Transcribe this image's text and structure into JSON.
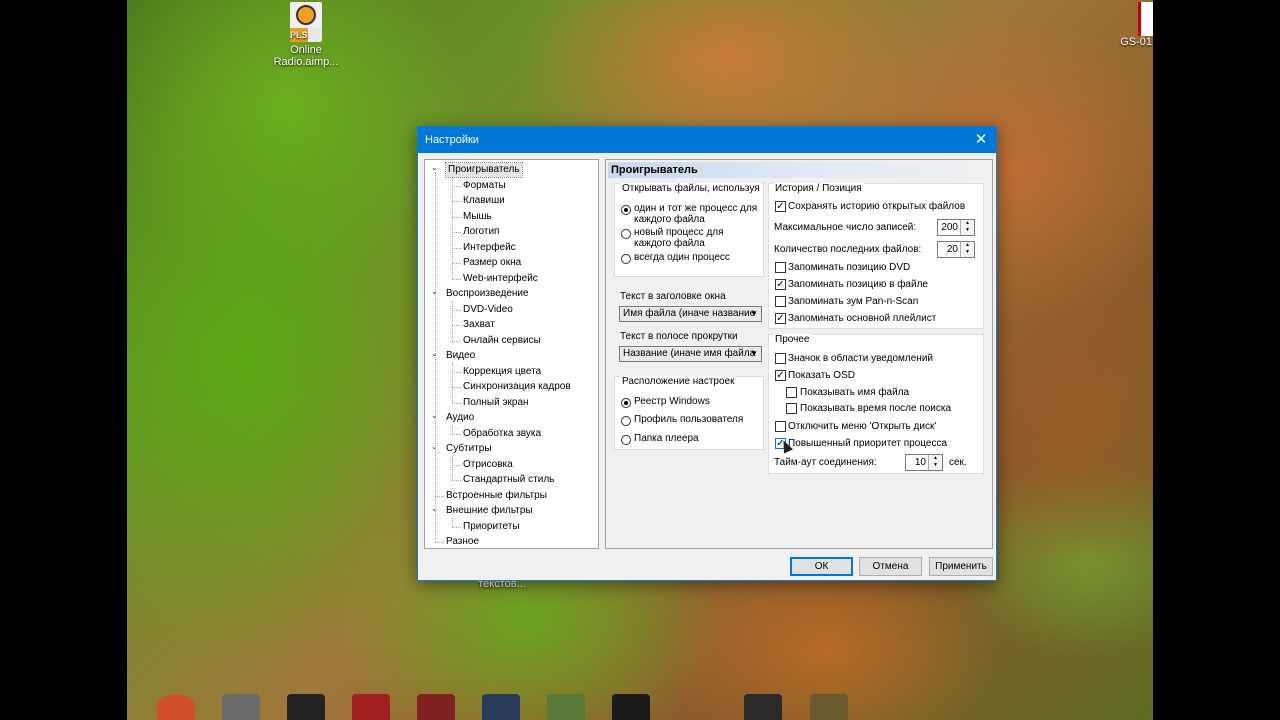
{
  "desktop": {
    "icon_online_radio": {
      "badge": "PLS",
      "label_line1": "Online",
      "label_line2": "Radio.aimp..."
    },
    "icon_right": {
      "label": "GS-01"
    },
    "hidden_icon_label": "текстов..."
  },
  "dialog": {
    "title": "Настройки",
    "close_glyph": "✕",
    "tree": [
      {
        "label": "Проигрыватель",
        "level": 0,
        "expander": "⌄"
      },
      {
        "label": "Форматы",
        "level": 1
      },
      {
        "label": "Клавиши",
        "level": 1
      },
      {
        "label": "Мышь",
        "level": 1
      },
      {
        "label": "Логотип",
        "level": 1
      },
      {
        "label": "Интерфейс",
        "level": 1
      },
      {
        "label": "Размер окна",
        "level": 1
      },
      {
        "label": "Web-интерфейс",
        "level": 1
      },
      {
        "label": "Воспроизведение",
        "level": 0,
        "expander": "⌄"
      },
      {
        "label": "DVD-Video",
        "level": 1
      },
      {
        "label": "Захват",
        "level": 1
      },
      {
        "label": "Онлайн сервисы",
        "level": 1
      },
      {
        "label": "Видео",
        "level": 0,
        "expander": "⌄"
      },
      {
        "label": "Коррекция цвета",
        "level": 1
      },
      {
        "label": "Синхронизация кадров",
        "level": 1
      },
      {
        "label": "Полный экран",
        "level": 1
      },
      {
        "label": "Аудио",
        "level": 0,
        "expander": "⌄"
      },
      {
        "label": "Обработка звука",
        "level": 1
      },
      {
        "label": "Субтитры",
        "level": 0,
        "expander": "⌄"
      },
      {
        "label": "Отрисовка",
        "level": 1
      },
      {
        "label": "Стандартный стиль",
        "level": 1
      },
      {
        "label": "Встроенные фильтры",
        "level": 0
      },
      {
        "label": "Внешние фильтры",
        "level": 0,
        "expander": "⌄"
      },
      {
        "label": "Приоритеты",
        "level": 1
      },
      {
        "label": "Разное",
        "level": 0
      }
    ],
    "panel": {
      "header": "Проигрыватель",
      "open_files": {
        "legend": "Открывать файлы, используя",
        "options": [
          {
            "line1": "один и тот же процесс для",
            "line2": "каждого файла",
            "selected": true
          },
          {
            "line1": "новый процесс для",
            "line2": "каждого файла",
            "selected": false
          },
          {
            "line1": "всегда один процесс",
            "line2": "",
            "selected": false
          }
        ]
      },
      "window_title": {
        "label": "Текст в заголовке окна",
        "value": "Имя файла (иначе название"
      },
      "seekbar_text": {
        "label": "Текст в полосе прокрутки",
        "value": "Название (иначе имя файла"
      },
      "settings_location": {
        "legend": "Расположение настроек",
        "options": [
          {
            "label": "Реестр Windows",
            "selected": true
          },
          {
            "label": "Профиль пользователя",
            "selected": false
          },
          {
            "label": "Папка плеера",
            "selected": false
          }
        ]
      },
      "history": {
        "legend": "История / Позиция",
        "save_history": {
          "label": "Сохранять историю открытых файлов",
          "checked": true
        },
        "max_records": {
          "label": "Максимальное число записей:",
          "value": "200"
        },
        "recent_count": {
          "label": "Количество последних файлов:",
          "value": "20"
        },
        "remember_dvd": {
          "label": "Запоминать позицию DVD",
          "checked": false
        },
        "remember_file": {
          "label": "Запоминать позицию в файле",
          "checked": true
        },
        "remember_pan": {
          "label": "Запоминать зум Pan-n-Scan",
          "checked": false
        },
        "remember_playlist": {
          "label": "Запоминать основной плейлист",
          "checked": true
        }
      },
      "other": {
        "legend": "Прочее",
        "tray_icon": {
          "label": "Значок в области уведомлений",
          "checked": false
        },
        "show_osd": {
          "label": "Показать OSD",
          "checked": true
        },
        "show_filename": {
          "label": "Показывать имя файла",
          "checked": false
        },
        "show_time": {
          "label": "Показывать время после поиска",
          "checked": false
        },
        "disable_open_disc": {
          "label": "Отключить меню 'Открыть диск'",
          "checked": false
        },
        "high_priority": {
          "label": "Повышенный приоритет процесса",
          "checked": true
        },
        "timeout": {
          "label": "Тайм-аут соединения:",
          "value": "10",
          "unit": "сек."
        }
      }
    },
    "buttons": {
      "ok": "ОК",
      "cancel": "Отмена",
      "apply": "Применить"
    }
  },
  "glyphs": {
    "check": "✓",
    "combo_arrow": "▼",
    "spin_up": "▲",
    "spin_down": "▼"
  }
}
